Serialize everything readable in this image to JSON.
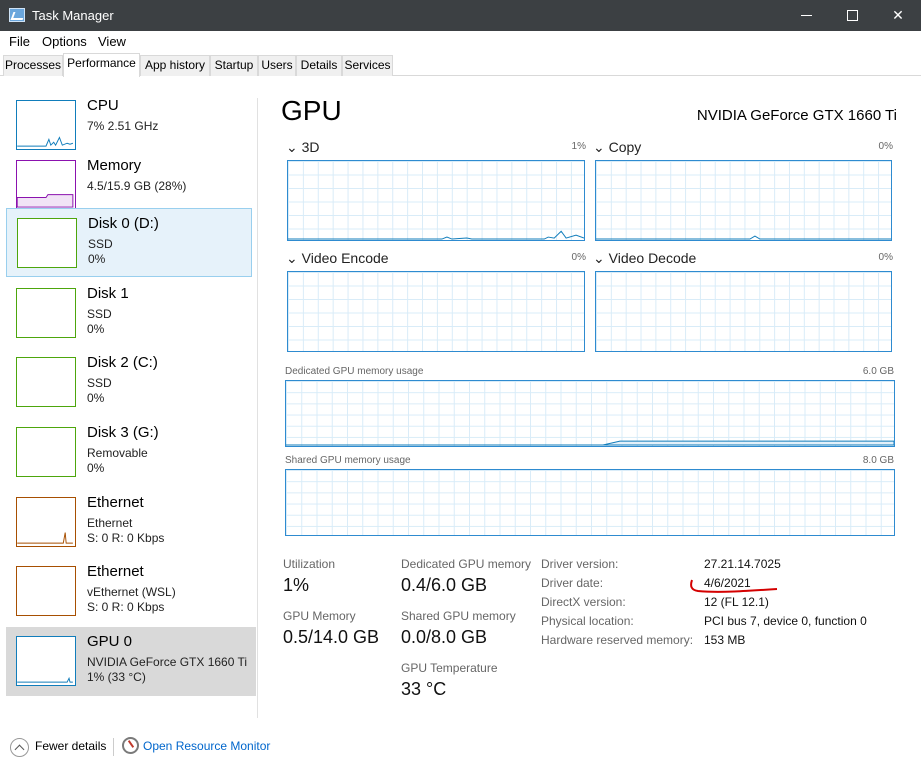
{
  "window": {
    "title": "Task Manager",
    "controls": {
      "minimize": "",
      "maximize": "",
      "close": "✕"
    }
  },
  "menu": [
    "File",
    "Options",
    "View"
  ],
  "tabs": [
    "Processes",
    "Performance",
    "App history",
    "Startup",
    "Users",
    "Details",
    "Services"
  ],
  "active_tab": "Performance",
  "sidebar": [
    {
      "name": "CPU",
      "sub1": "7% 2.51 GHz",
      "sub2": "",
      "color": "#117dbb"
    },
    {
      "name": "Memory",
      "sub1": "4.5/15.9 GB (28%)",
      "sub2": "",
      "color": "#8b12ae"
    },
    {
      "name": "Disk 0 (D:)",
      "sub1": "SSD",
      "sub2": "0%",
      "color": "#4da60c"
    },
    {
      "name": "Disk 1",
      "sub1": "SSD",
      "sub2": "0%",
      "color": "#4da60c"
    },
    {
      "name": "Disk 2 (C:)",
      "sub1": "SSD",
      "sub2": "0%",
      "color": "#4da60c"
    },
    {
      "name": "Disk 3 (G:)",
      "sub1": "Removable",
      "sub2": "0%",
      "color": "#4da60c"
    },
    {
      "name": "Ethernet",
      "sub1": "Ethernet",
      "sub2": "S: 0 R: 0 Kbps",
      "color": "#a74f01"
    },
    {
      "name": "Ethernet",
      "sub1": "vEthernet (WSL)",
      "sub2": "S: 0 R: 0 Kbps",
      "color": "#a74f01"
    },
    {
      "name": "GPU 0",
      "sub1": "NVIDIA GeForce GTX 1660 Ti",
      "sub2": "1% (33 °C)",
      "color": "#117dbb"
    }
  ],
  "main": {
    "title": "GPU",
    "model": "NVIDIA GeForce GTX 1660 Ti",
    "engines": [
      {
        "label": "3D",
        "pct": "1%"
      },
      {
        "label": "Copy",
        "pct": "0%"
      },
      {
        "label": "Video Encode",
        "pct": "0%"
      },
      {
        "label": "Video Decode",
        "pct": "0%"
      }
    ],
    "dedicated_graph": {
      "label": "Dedicated GPU memory usage",
      "max": "6.0 GB"
    },
    "shared_graph": {
      "label": "Shared GPU memory usage",
      "max": "8.0 GB"
    },
    "stats": {
      "utilization_label": "Utilization",
      "utilization_value": "1%",
      "dedicated_label": "Dedicated GPU memory",
      "dedicated_value": "0.4/6.0 GB",
      "gpu_memory_label": "GPU Memory",
      "gpu_memory_value": "0.5/14.0 GB",
      "shared_label": "Shared GPU memory",
      "shared_value": "0.0/8.0 GB",
      "temp_label": "GPU Temperature",
      "temp_value": "33 °C"
    },
    "info": [
      {
        "label": "Driver version:",
        "value": "27.21.14.7025"
      },
      {
        "label": "Driver date:",
        "value": "4/6/2021"
      },
      {
        "label": "DirectX version:",
        "value": "12 (FL 12.1)"
      },
      {
        "label": "Physical location:",
        "value": "PCI bus 7, device 0, function 0"
      },
      {
        "label": "Hardware reserved memory:",
        "value": "153 MB"
      }
    ]
  },
  "footer": {
    "fewer_details": "Fewer details",
    "resource_monitor": "Open Resource Monitor"
  },
  "colors": {
    "accent": "#117dbb",
    "annotation": "#d40000"
  }
}
